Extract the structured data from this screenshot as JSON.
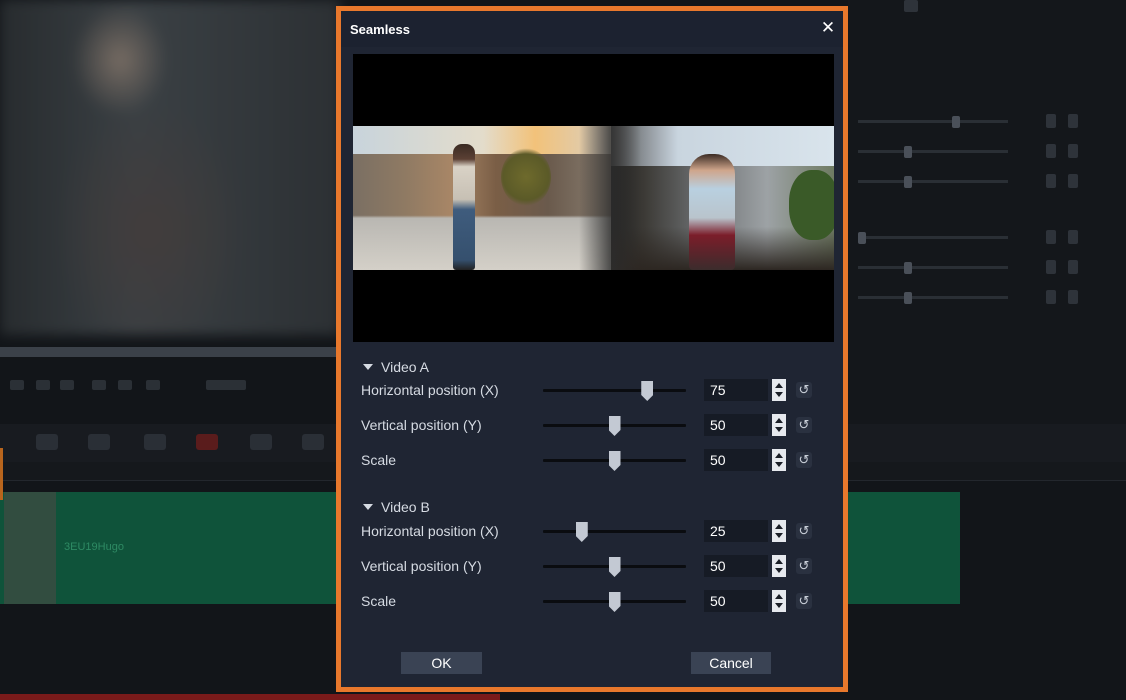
{
  "background": {
    "clip_label": "3EU19Hugo"
  },
  "dialog": {
    "title": "Seamless",
    "close_glyph": "✕",
    "accent_color": "#e8782c",
    "sections": [
      {
        "label": "Video A",
        "props": [
          {
            "label": "Horizontal position (X)",
            "value": "75",
            "fraction": 0.75
          },
          {
            "label": "Vertical position (Y)",
            "value": "50",
            "fraction": 0.5
          },
          {
            "label": "Scale",
            "value": "50",
            "fraction": 0.5
          }
        ]
      },
      {
        "label": "Video B",
        "props": [
          {
            "label": "Horizontal position (X)",
            "value": "25",
            "fraction": 0.25
          },
          {
            "label": "Vertical position (Y)",
            "value": "50",
            "fraction": 0.5
          },
          {
            "label": "Scale",
            "value": "50",
            "fraction": 0.5
          }
        ]
      }
    ],
    "reset_glyph": "↺",
    "ok_label": "OK",
    "cancel_label": "Cancel"
  }
}
